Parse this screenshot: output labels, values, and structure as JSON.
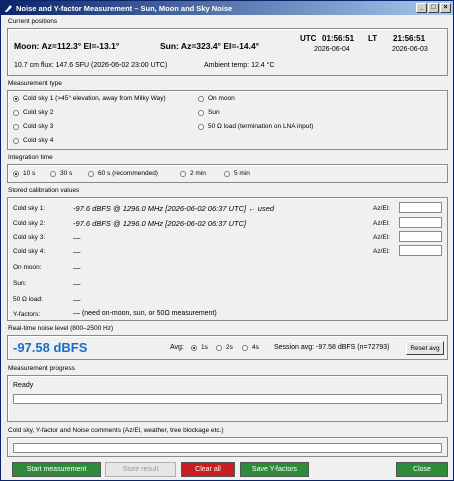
{
  "window": {
    "title": "Noise and Y-factor Measurement – Sun, Moon and Sky Noise",
    "min_glyph": "_",
    "max_glyph": "□",
    "close_glyph": "×"
  },
  "positions": {
    "section_label": "Current positions",
    "moon": "Moon: Az=112.3°  El=-13.1°",
    "sun": "Sun: Az=323.4°  El=-14.4°",
    "utc_label": "UTC",
    "utc_time": "01:56:51",
    "utc_date": "2026-06-04",
    "lt_label": "LT",
    "lt_time": "21:56:51",
    "lt_date": "2026-06-03",
    "flux": "10.7 cm flux: 147.6 SFU  (2026-06-02 23:00 UTC)",
    "ambient": "Ambient temp: 12.4 °C"
  },
  "measurement_type": {
    "section_label": "Measurement type",
    "options_left": [
      {
        "label": "Cold sky 1  (>45° elevation, away from Milky Way)",
        "selected": true
      },
      {
        "label": "Cold sky 2",
        "selected": false
      },
      {
        "label": "Cold sky 3",
        "selected": false
      },
      {
        "label": "Cold sky 4",
        "selected": false
      }
    ],
    "options_right": [
      {
        "label": "On moon",
        "selected": false
      },
      {
        "label": "Sun",
        "selected": false
      },
      {
        "label": "50 Ω load  (termination on LNA input)",
        "selected": false
      }
    ]
  },
  "integration": {
    "section_label": "Integration time",
    "options": [
      {
        "label": "10 s",
        "selected": true
      },
      {
        "label": "30 s",
        "selected": false
      },
      {
        "label": "60 s  (recommended)",
        "selected": false
      },
      {
        "label": "2 min",
        "selected": false
      },
      {
        "label": "5 min",
        "selected": false
      }
    ]
  },
  "calibration": {
    "section_label": "Stored calibration values",
    "rows": [
      {
        "label": "Cold sky 1:",
        "value": "-97.6 dBFS  @ 1296.0 MHz  [2026-06-02 06:37 UTC]  ← used"
      },
      {
        "label": "Cold sky 2:",
        "value": "-97.6 dBFS  @ 1296.0 MHz  [2026-06-02 06:37 UTC]"
      },
      {
        "label": "Cold sky 3:",
        "value": "—"
      },
      {
        "label": "Cold sky 4:",
        "value": "—"
      },
      {
        "label": "On moon:",
        "value": "—"
      },
      {
        "label": "Sun:",
        "value": "—"
      },
      {
        "label": "50 Ω load:",
        "value": "—"
      },
      {
        "label": "Y-factors:",
        "value": "—    (need on-moon, sun, or 50Ω measurement)"
      }
    ],
    "azel_label": "Az/El:"
  },
  "noise": {
    "section_label": "Real-time noise level  (800–2500 Hz)",
    "value": "-97.58 dBFS",
    "avg_label": "Avg:",
    "avg_options": [
      {
        "label": "1s",
        "selected": true
      },
      {
        "label": "2s",
        "selected": false
      },
      {
        "label": "4s",
        "selected": false
      }
    ],
    "session_avg": "Session avg: -97.58 dBFS  (n=72793)",
    "reset_label": "Reset avg"
  },
  "progress": {
    "section_label": "Measurement progress",
    "status": "Ready",
    "percent": 0
  },
  "comments": {
    "section_label": "Cold sky, Y-factor and Noise comments  (Az/El, weather, tree blockage etc.)",
    "value": ""
  },
  "buttons": {
    "start": "Start measurement",
    "store": "Store result",
    "clear": "Clear all",
    "save_y": "Save Y-factors",
    "close": "Close"
  },
  "colors": {
    "accent_blue": "#1a6fc4",
    "green_button": "#2e8b3a",
    "red_button": "#c81e1e",
    "disabled_button": "#e6e6e6"
  }
}
